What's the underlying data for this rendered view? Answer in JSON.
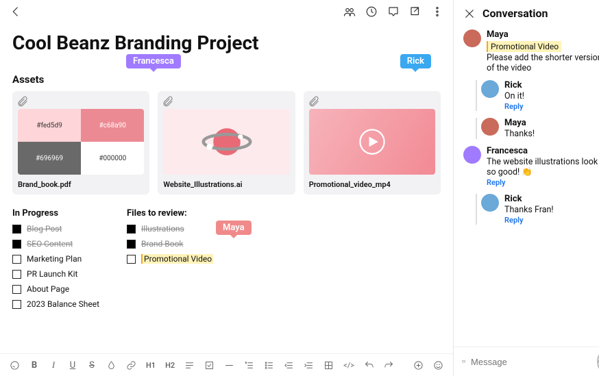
{
  "header": {
    "title": "Cool Beanz Branding Project"
  },
  "sections": {
    "assets_title": "Assets",
    "in_progress_title": "In Progress",
    "files_review_title": "Files to review:"
  },
  "cursors": {
    "francesca": {
      "label": "Francesca",
      "color": "#a07bff"
    },
    "rick": {
      "label": "Rick",
      "color": "#3aa8f0"
    },
    "maya": {
      "label": "Maya",
      "color": "#f08a8a"
    }
  },
  "assets": [
    {
      "filename": "Brand_book.pdf",
      "swatches": [
        {
          "hex": "#fed5d9",
          "bg": "#fed5d9",
          "fg": "#333"
        },
        {
          "hex": "#c68a90",
          "bg": "#ec8a93",
          "fg": "#fff"
        },
        {
          "hex": "#696969",
          "bg": "#696969",
          "fg": "#fff"
        },
        {
          "hex": "#000000",
          "bg": "#ffffff",
          "fg": "#333"
        }
      ]
    },
    {
      "filename": "Website_Illustrations.ai"
    },
    {
      "filename": "Promotional_video_mp4"
    }
  ],
  "in_progress": [
    {
      "label": "Blog Post",
      "done": true
    },
    {
      "label": "SEO Content",
      "done": true
    },
    {
      "label": "Marketing Plan",
      "done": false
    },
    {
      "label": "PR Launch Kit",
      "done": false
    },
    {
      "label": "About Page",
      "done": false
    },
    {
      "label": "2023 Balance Sheet",
      "done": false
    }
  ],
  "files_review": [
    {
      "label": "Illustrations",
      "done": true
    },
    {
      "label": "Brand Book",
      "done": true
    },
    {
      "label": "Promotional Video",
      "done": false,
      "hl": true
    }
  ],
  "conversation": {
    "title": "Conversation",
    "composer_placeholder": "Message",
    "messages": [
      {
        "name": "Maya",
        "avatar_bg": "#c96a5a",
        "chip": "Promotional Video",
        "text": "Please add the shorter version of the video",
        "nested": false,
        "reply": false
      },
      {
        "name": "Rick",
        "avatar_bg": "#6aa9d8",
        "text": "On it!",
        "nested": true,
        "reply": true
      },
      {
        "name": "Maya",
        "avatar_bg": "#c96a5a",
        "text": "Thanks!",
        "nested": true,
        "reply": false
      },
      {
        "name": "Francesca",
        "avatar_bg": "#a07bff",
        "text": "The website illustrations look so good! 👏",
        "nested": false,
        "reply": true
      },
      {
        "name": "Rick",
        "avatar_bg": "#6aa9d8",
        "text": "Thanks Fran!",
        "nested": true,
        "reply": true
      }
    ]
  },
  "toolbar": {
    "reply_label": "Reply"
  }
}
